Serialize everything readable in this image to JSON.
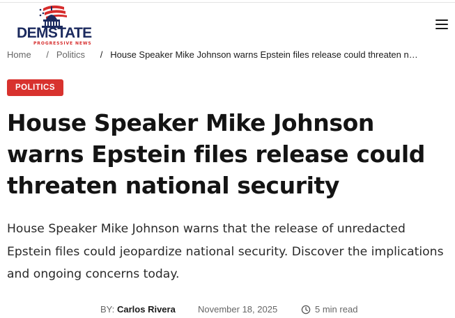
{
  "brand": {
    "name": "DEMSTATE",
    "tagline": "PROGRESSIVE NEWS",
    "colors": {
      "navy": "#1b2a5e",
      "red": "#d62c2c"
    }
  },
  "header": {
    "menu_icon": "hamburger-menu-icon"
  },
  "breadcrumb": {
    "items": [
      {
        "label": "Home"
      },
      {
        "label": "Politics"
      },
      {
        "label": "House Speaker Mike Johnson warns Epstein files release could threaten n…"
      }
    ],
    "separator": "/"
  },
  "article": {
    "category": "POLITICS",
    "category_color": "#d8322e",
    "headline": "House Speaker Mike Johnson warns Epstein files release could threaten national security",
    "dek": "House Speaker Mike Johnson warns that the release of unredacted Epstein files could jeopardize national security. Discover the implications and ongoing concerns today.",
    "byline_label": "BY:",
    "author": "Carlos Rivera",
    "date": "November 18, 2025",
    "read_time": "5 min read",
    "read_time_icon": "clock-icon"
  }
}
